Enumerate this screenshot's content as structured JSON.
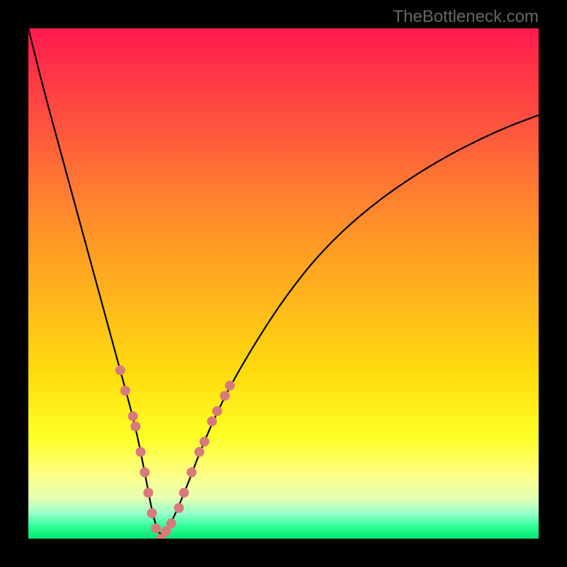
{
  "watermark": "TheBottleneck.com",
  "chart_data": {
    "type": "line",
    "title": "",
    "xlabel": "",
    "ylabel": "",
    "xlim": [
      0,
      100
    ],
    "ylim": [
      0,
      100
    ],
    "grid": false,
    "legend": false,
    "series": [
      {
        "name": "bottleneck-curve",
        "color": "#000000",
        "x": [
          0,
          3,
          6,
          9,
          12,
          15,
          18,
          21,
          23,
          24.5,
          26,
          28,
          31,
          34,
          38,
          43,
          50,
          58,
          68,
          80,
          92,
          100
        ],
        "y": [
          100,
          88,
          77,
          66,
          55,
          44,
          33,
          22,
          12,
          4,
          0,
          3,
          10,
          18,
          27,
          36,
          47,
          57,
          66,
          74,
          80,
          83
        ]
      }
    ],
    "markers": {
      "name": "highlight-dots",
      "color": "#d97a7a",
      "radius_px": 7,
      "points": [
        {
          "x": 18,
          "y": 33
        },
        {
          "x": 19,
          "y": 29
        },
        {
          "x": 20.5,
          "y": 24
        },
        {
          "x": 21,
          "y": 22
        },
        {
          "x": 22,
          "y": 17
        },
        {
          "x": 22.8,
          "y": 13
        },
        {
          "x": 23.5,
          "y": 9
        },
        {
          "x": 24.2,
          "y": 5
        },
        {
          "x": 25,
          "y": 2
        },
        {
          "x": 26,
          "y": 0
        },
        {
          "x": 27,
          "y": 1.5
        },
        {
          "x": 28,
          "y": 3
        },
        {
          "x": 29.5,
          "y": 6
        },
        {
          "x": 30.5,
          "y": 9
        },
        {
          "x": 32,
          "y": 13
        },
        {
          "x": 33.5,
          "y": 17
        },
        {
          "x": 34.5,
          "y": 19
        },
        {
          "x": 36,
          "y": 23
        },
        {
          "x": 37,
          "y": 25
        },
        {
          "x": 38.5,
          "y": 28
        },
        {
          "x": 39.5,
          "y": 30
        }
      ]
    }
  }
}
